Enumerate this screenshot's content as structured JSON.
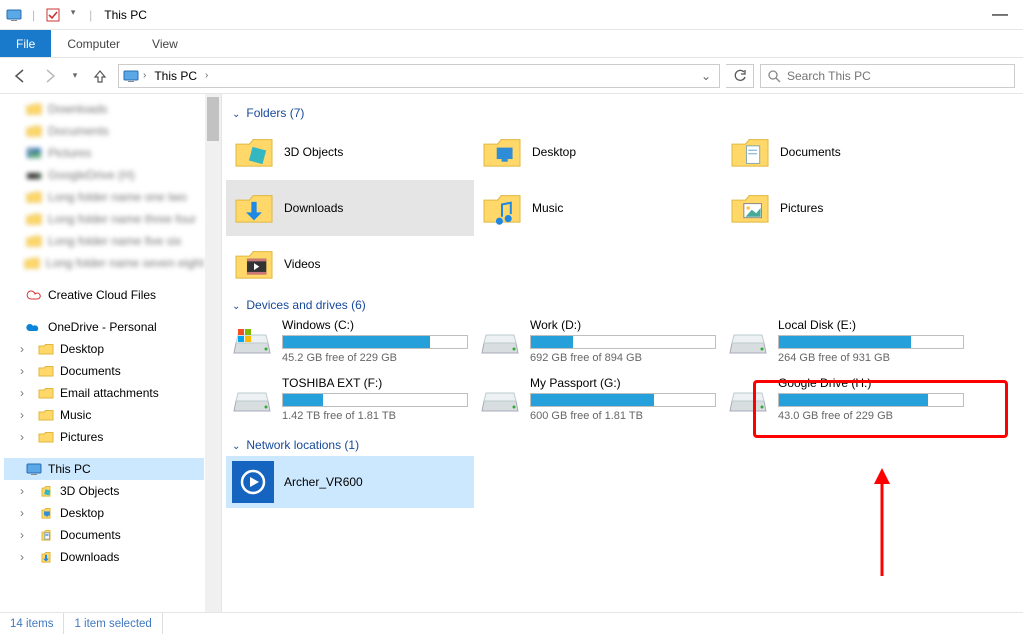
{
  "window": {
    "title": "This PC"
  },
  "ribbon": {
    "file": "File",
    "computer": "Computer",
    "view": "View"
  },
  "address": {
    "crumb": "This PC"
  },
  "search": {
    "placeholder": "Search This PC"
  },
  "sidebar": {
    "quick": [
      {
        "label": "Downloads",
        "blur": true,
        "icon": "folder"
      },
      {
        "label": "Documents",
        "blur": true,
        "icon": "folder"
      },
      {
        "label": "Pictures",
        "blur": true,
        "icon": "pictures"
      },
      {
        "label": "GoogleDrive (H)",
        "blur": true,
        "icon": "drive-dark"
      },
      {
        "label": "Long folder name one two",
        "blur": true,
        "icon": "folder"
      },
      {
        "label": "Long folder name three four",
        "blur": true,
        "icon": "folder"
      },
      {
        "label": "Long folder name five six",
        "blur": true,
        "icon": "folder"
      },
      {
        "label": "Long folder name seven eight",
        "blur": true,
        "icon": "folder"
      }
    ],
    "creative": "Creative Cloud Files",
    "onedrive": "OneDrive - Personal",
    "items": [
      {
        "label": "Desktop",
        "icon": "folder",
        "expandable": true
      },
      {
        "label": "Documents",
        "icon": "folder",
        "expandable": true
      },
      {
        "label": "Email attachments",
        "icon": "folder",
        "expandable": true
      },
      {
        "label": "Music",
        "icon": "folder",
        "expandable": true
      },
      {
        "label": "Pictures",
        "icon": "folder",
        "expandable": true
      }
    ],
    "thispc": "This PC",
    "thispc_children": [
      {
        "label": "3D Objects",
        "icon": "3d",
        "expandable": true
      },
      {
        "label": "Desktop",
        "icon": "desktop",
        "expandable": true
      },
      {
        "label": "Documents",
        "icon": "documents",
        "expandable": true
      },
      {
        "label": "Downloads",
        "icon": "downloads",
        "expandable": true
      }
    ]
  },
  "folders": {
    "heading": "Folders (7)",
    "items": [
      {
        "name": "3D Objects",
        "icon": "3d"
      },
      {
        "name": "Desktop",
        "icon": "desktop"
      },
      {
        "name": "Documents",
        "icon": "documents"
      },
      {
        "name": "Downloads",
        "icon": "downloads",
        "selected": true
      },
      {
        "name": "Music",
        "icon": "music"
      },
      {
        "name": "Pictures",
        "icon": "pictures"
      },
      {
        "name": "Videos",
        "icon": "videos"
      }
    ]
  },
  "drives": {
    "heading": "Devices and drives (6)",
    "items": [
      {
        "name": "Windows (C:)",
        "free": "45.2 GB free of 229 GB",
        "pct": 80,
        "icon": "windows"
      },
      {
        "name": "Work (D:)",
        "free": "692 GB free of 894 GB",
        "pct": 23,
        "icon": "hdd"
      },
      {
        "name": "Local Disk (E:)",
        "free": "264 GB free of 931 GB",
        "pct": 72,
        "icon": "hdd"
      },
      {
        "name": "TOSHIBA EXT (F:)",
        "free": "1.42 TB free of 1.81 TB",
        "pct": 22,
        "icon": "hdd"
      },
      {
        "name": "My Passport (G:)",
        "free": "600 GB free of 1.81 TB",
        "pct": 67,
        "icon": "hdd"
      },
      {
        "name": "Google Drive (H:)",
        "free": "43.0 GB free of 229 GB",
        "pct": 81,
        "icon": "hdd",
        "highlight": true
      }
    ]
  },
  "network": {
    "heading": "Network locations (1)",
    "items": [
      {
        "name": "Archer_VR600"
      }
    ]
  },
  "status": {
    "items": "14 items",
    "selected": "1 item selected"
  }
}
